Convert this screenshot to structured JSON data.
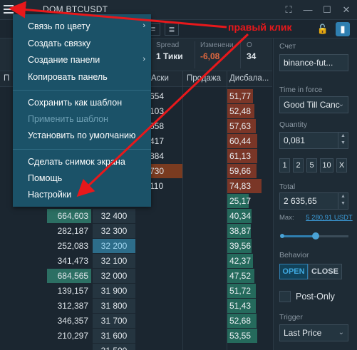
{
  "window": {
    "title_prefix": "DOM",
    "title": "DOM BTCUSDT"
  },
  "stats": [
    {
      "label": "Spread",
      "value": "1 Тики",
      "neg": false
    },
    {
      "label": "Изменени",
      "value": "-6,08",
      "neg": true
    },
    {
      "label": "О",
      "value": "34",
      "neg": false
    }
  ],
  "columns": {
    "bids": "П",
    "asks": "Аски",
    "sell": "Продажа",
    "imbalance": "Дисбала..."
  },
  "context_menu": {
    "items": [
      {
        "label": "Связь по цвету",
        "submenu": true,
        "disabled": false
      },
      {
        "label": "Создать связку",
        "submenu": false,
        "disabled": false
      },
      {
        "label": "Создание панели",
        "submenu": true,
        "disabled": false
      },
      {
        "label": "Копировать панель",
        "submenu": false,
        "disabled": false
      },
      {
        "label": "Сохранить как шаблон",
        "submenu": false,
        "disabled": false
      },
      {
        "label": "Применить шаблон",
        "submenu": false,
        "disabled": true
      },
      {
        "label": "Установить по умолчанию",
        "submenu": false,
        "disabled": false
      },
      {
        "label": "Сделать снимок экрана",
        "submenu": false,
        "disabled": false
      },
      {
        "label": "Помощь",
        "submenu": false,
        "disabled": false
      },
      {
        "label": "Настройки",
        "submenu": false,
        "disabled": false
      }
    ]
  },
  "annotation": {
    "text": "правый клик",
    "color": "#e8181b"
  },
  "asks_rows": [
    {
      "ask": "654",
      "imb": "51,77"
    },
    {
      "ask": "103",
      "imb": "52,48"
    },
    {
      "ask": "558",
      "imb": "57,63"
    },
    {
      "ask": "417",
      "imb": "60,44"
    },
    {
      "ask": "884",
      "imb": "61,13"
    },
    {
      "ask": "730",
      "imb": "59,66"
    },
    {
      "ask": "110",
      "imb": "74,83"
    }
  ],
  "bid_rows": [
    {
      "bid": "",
      "price": "",
      "imb": "25,17",
      "bid_hl": false,
      "cur": false
    },
    {
      "bid": "664,603",
      "price": "32 400",
      "imb": "40,34",
      "bid_hl": true,
      "cur": false
    },
    {
      "bid": "282,187",
      "price": "32 300",
      "imb": "38,87",
      "bid_hl": false,
      "cur": false
    },
    {
      "bid": "252,083",
      "price": "32 200",
      "imb": "39,56",
      "bid_hl": false,
      "cur": true
    },
    {
      "bid": "341,473",
      "price": "32 100",
      "imb": "42,37",
      "bid_hl": false,
      "cur": false
    },
    {
      "bid": "684,565",
      "price": "32 000",
      "imb": "47,52",
      "bid_hl": true,
      "cur": false
    },
    {
      "bid": "139,157",
      "price": "31 900",
      "imb": "51,72",
      "bid_hl": false,
      "cur": false
    },
    {
      "bid": "312,387",
      "price": "31 800",
      "imb": "51,43",
      "bid_hl": false,
      "cur": false
    },
    {
      "bid": "346,357",
      "price": "31 700",
      "imb": "52,68",
      "bid_hl": false,
      "cur": false
    },
    {
      "bid": "210,297",
      "price": "31 600",
      "imb": "53,55",
      "bid_hl": false,
      "cur": false
    },
    {
      "bid": "",
      "price": "31 500",
      "imb": "",
      "bid_hl": false,
      "cur": false
    }
  ],
  "panel": {
    "account_label": "Счет",
    "account_value": "binance-fut...",
    "tif_label": "Time in force",
    "tif_value": "Good Till Canc",
    "qty_label": "Quantity",
    "qty_value": "0,081",
    "qty_buttons": [
      "1",
      "2",
      "5",
      "10",
      "X"
    ],
    "total_label": "Total",
    "total_value": "2 635,65",
    "max_label": "Max:",
    "max_value": "5 280,91 USDT",
    "slider_fraction": 0.5,
    "behavior_label": "Behavior",
    "open_label": "OPEN",
    "close_label": "CLOSE",
    "postonly_label": "Post-Only",
    "trigger_label": "Trigger",
    "trigger_value": "Last Price"
  }
}
